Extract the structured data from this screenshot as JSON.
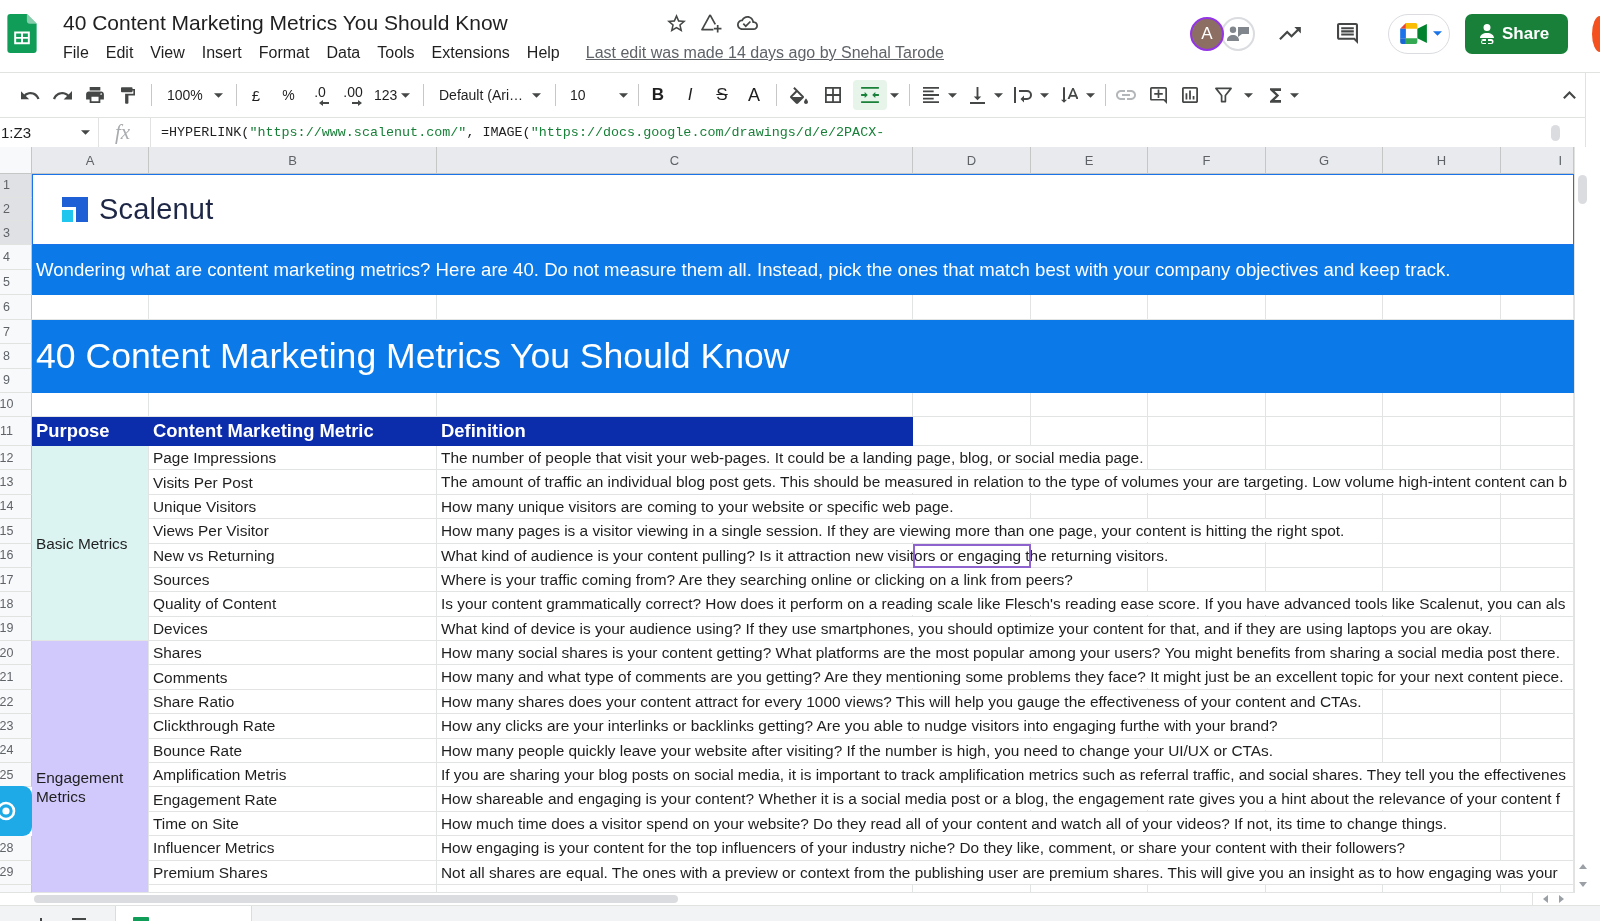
{
  "window": {
    "title": "40 Content Marketing Metrics You Should Know",
    "last_edit": "Last edit was made 14 days ago by Snehal Tarode"
  },
  "menu": [
    "File",
    "Edit",
    "View",
    "Insert",
    "Format",
    "Data",
    "Tools",
    "Extensions",
    "Help"
  ],
  "account": {
    "initial": "A",
    "share_label": "Share"
  },
  "toolbar": {
    "zoom": "100%",
    "currency": "£",
    "percent": "%",
    "decrease_decimals": ".0",
    "increase_decimals": ".00",
    "number_format": "123",
    "font": "Default (Ari…",
    "font_size": "10",
    "bold": "B",
    "italic": "I",
    "strikethrough": "S",
    "text_color": "A",
    "merge_active": true,
    "link_disabled": true
  },
  "formula_bar": {
    "name_box": "1:Z3",
    "fx": "fx",
    "formula": [
      {
        "kind": "code",
        "text": "=HYPERLINK("
      },
      {
        "kind": "string",
        "text": "\"https://www.scalenut.com/\""
      },
      {
        "kind": "code",
        "text": ", IMAGE("
      },
      {
        "kind": "string",
        "text": "\"https://docs.google.com/drawings/d/e/2PACX-"
      }
    ]
  },
  "sheet": {
    "columns": [
      {
        "label": "A",
        "selected": true
      },
      {
        "label": "B",
        "selected": true
      },
      {
        "label": "C",
        "selected": true
      },
      {
        "label": "D",
        "selected": true
      },
      {
        "label": "E",
        "selected": true
      },
      {
        "label": "F",
        "selected": true
      },
      {
        "label": "G",
        "selected": true
      },
      {
        "label": "H",
        "selected": true
      },
      {
        "label": "I",
        "selected": true
      }
    ],
    "row_headers": [
      {
        "label": "1",
        "selected": true
      },
      {
        "label": "2",
        "selected": true
      },
      {
        "label": "3",
        "selected": true
      },
      {
        "label": "4",
        "selected": false
      },
      {
        "label": "5",
        "selected": false
      },
      {
        "label": "6",
        "selected": false
      },
      {
        "label": "7",
        "selected": false
      },
      {
        "label": "8",
        "selected": false
      },
      {
        "label": "9",
        "selected": false
      },
      {
        "label": "10",
        "selected": false
      },
      {
        "label": "11",
        "selected": false
      }
    ],
    "logo": {
      "text": "Scalenut",
      "selected": true
    },
    "intro": "Wondering what are content marketing metrics? Here are 40. Do not measure them all. Instead, pick the ones that match best with your company objectives and keep track.",
    "heading": "40 Content Marketing Metrics You Should Know",
    "table": {
      "headings": [
        "Purpose",
        "Content Marketing Metric",
        "Definition"
      ],
      "groups": [
        {
          "purpose": "Basic Metrics",
          "color": "#dbf4f2",
          "rows": [
            {
              "row_header": {
                "label": "12",
                "selected": false
              },
              "metric": "Page Impressions",
              "definition": "The number of people that visit your web-pages. It could be a landing page, blog, or social media page.",
              "collaborator_selected": false
            },
            {
              "row_header": {
                "label": "13",
                "selected": false
              },
              "metric": "Visits Per Post",
              "definition": "The amount of traffic an individual blog post gets. This should be measured in relation to the type of volumes your are targeting. Low volume high-intent content can b",
              "collaborator_selected": false
            },
            {
              "row_header": {
                "label": "14",
                "selected": false
              },
              "metric": "Unique Visitors",
              "definition": "How many unique visitors are coming to your website or specific web page.",
              "collaborator_selected": false
            },
            {
              "row_header": {
                "label": "15",
                "selected": false
              },
              "metric": "Views Per Visitor",
              "definition": "How many pages is a visitor viewing in a single session. If they are viewing more than one page, your content is hitting the right spot.",
              "collaborator_selected": false
            },
            {
              "row_header": {
                "label": "16",
                "selected": false
              },
              "metric": "New vs Returning",
              "definition": "What kind of audience is your content pulling? Is it attraction new visitors or engaging the returning visitors.",
              "collaborator_selected": true
            },
            {
              "row_header": {
                "label": "17",
                "selected": false
              },
              "metric": "Sources",
              "definition": "Where is your traffic coming from? Are they searching online or clicking on a link from peers?",
              "collaborator_selected": false
            },
            {
              "row_header": {
                "label": "18",
                "selected": false
              },
              "metric": "Quality of Content",
              "definition": "Is your content grammatically correct? How does it perform on a reading scale like Flesch's reading ease score. If you have advanced tools like Scalenut, you can als",
              "collaborator_selected": false
            },
            {
              "row_header": {
                "label": "19",
                "selected": false
              },
              "metric": "Devices",
              "definition": "What kind of device is your audience using? If they use smartphones, you should optimize your content for that, and if they are using laptops you are okay.",
              "collaborator_selected": false
            }
          ]
        },
        {
          "purpose": "Engagement Metrics",
          "color": "#d1c9fb",
          "rows": [
            {
              "row_header": {
                "label": "20",
                "selected": false
              },
              "metric": "Shares",
              "definition": "How many social shares is your content getting? What platforms are the most popular among your users? You might benefits from sharing a social media post there.",
              "collaborator_selected": false
            },
            {
              "row_header": {
                "label": "21",
                "selected": false
              },
              "metric": "Comments",
              "definition": "How many and what type of comments are you getting? Are they mentioning some problems they face? It might just be an excellent topic for your next content piece.",
              "collaborator_selected": false
            },
            {
              "row_header": {
                "label": "22",
                "selected": false
              },
              "metric": "Share Ratio",
              "definition": "How many shares does your content attract for every 1000 views? This will help you gauge the effectiveness of your content and CTAs.",
              "collaborator_selected": false
            },
            {
              "row_header": {
                "label": "23",
                "selected": false
              },
              "metric": "Clickthrough Rate",
              "definition": "How any clicks are your interlinks or backlinks getting? Are you able to nudge visitors into engaging furthe with your brand?",
              "collaborator_selected": false
            },
            {
              "row_header": {
                "label": "24",
                "selected": false
              },
              "metric": "Bounce Rate",
              "definition": "How many people quickly leave your website after visiting? If the number is high, you need to change your UI/UX or CTAs.",
              "collaborator_selected": false
            },
            {
              "row_header": {
                "label": "25",
                "selected": false
              },
              "metric": "Amplification Metris",
              "definition": "If you are sharing your blog posts on social media, it is important to track amplification metrics such as referral traffic, and social shares. They tell you the effectivenes",
              "collaborator_selected": false
            },
            {
              "metric": "Engagement Rate",
              "definition": "How shareable and engaging is your content? Whether it is a social media post or a blog, the engagement rate gives you a hint about the relevance of your content f",
              "collaborator_selected": false
            },
            {
              "metric": "Time on Site",
              "definition": "How much time does a visitor spend on your website? Do they read all of your content and watch all of your videos? If not, its time to change things.",
              "collaborator_selected": false
            },
            {
              "row_header": {
                "label": "28",
                "selected": false
              },
              "metric": "Influencer Metrics",
              "definition": "How engaging is your content for the top influencers of your industry niche? Do they like, comment, or share your content with their followers?",
              "collaborator_selected": false
            },
            {
              "row_header": {
                "label": "29",
                "selected": false
              },
              "metric": "Premium Shares",
              "definition": "Not all shares are equal. The ones with a preview or context from the publishing user are premium shares. This will give you an insight as to how engaging was your",
              "collaborator_selected": false
            }
          ]
        }
      ]
    }
  }
}
